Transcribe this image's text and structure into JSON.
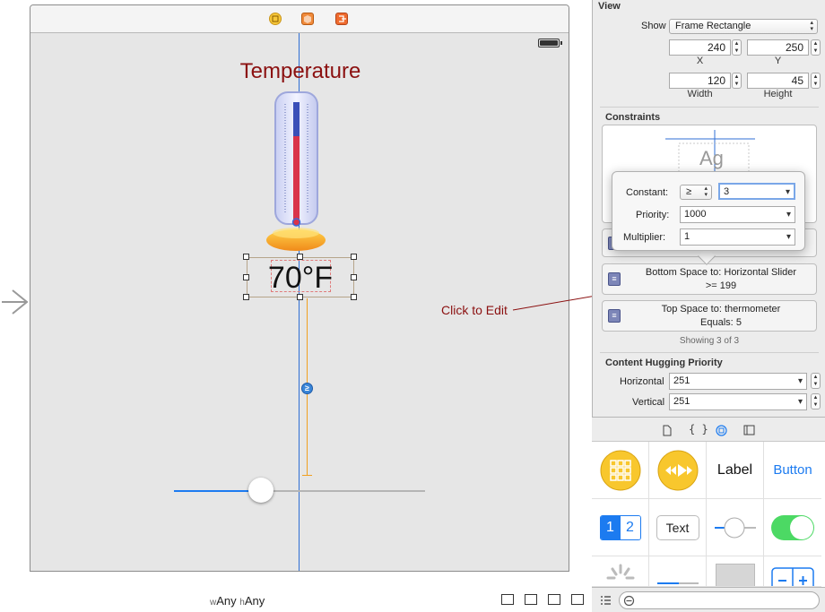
{
  "scene": {
    "title_label": "Temperature",
    "value_label": "70°F",
    "slider": {
      "value_fraction": 0.35
    },
    "constraint_badge": "≥",
    "dock_icons": [
      "view-controller-icon",
      "first-responder-icon",
      "exit-icon"
    ]
  },
  "bottom_bar": {
    "w_prefix": "w",
    "w_value": "Any",
    "h_prefix": "h",
    "h_value": "Any"
  },
  "annotation": {
    "text": "Click to Edit"
  },
  "inspector": {
    "view": {
      "heading": "View",
      "show_label": "Show",
      "show_value": "Frame Rectangle",
      "x": "240",
      "y": "250",
      "x_label": "X",
      "y_label": "Y",
      "width": "120",
      "height": "45",
      "width_label": "Width",
      "height_label": "Height"
    },
    "constraints": {
      "heading": "Constraints",
      "preview_text": "Ag",
      "items": [
        {
          "label": "Bottom Space to:",
          "target": "Horizontal Slider",
          "relation": ">=",
          "value": "199"
        },
        {
          "label": "Top Space to:",
          "target": "thermometer",
          "relation": "Equals:",
          "value": "5"
        }
      ],
      "showing": "Showing 3 of 3"
    },
    "popover": {
      "constant_label": "Constant:",
      "constant_relation": "≥",
      "constant_value": "3",
      "priority_label": "Priority:",
      "priority_value": "1000",
      "multiplier_label": "Multiplier:",
      "multiplier_value": "1"
    },
    "hugging": {
      "heading": "Content Hugging Priority",
      "horizontal_label": "Horizontal",
      "horizontal_value": "251",
      "vertical_label": "Vertical",
      "vertical_value": "251"
    }
  },
  "library": {
    "tabs": [
      "file-template-icon",
      "code-snippet-icon",
      "object-library-icon",
      "media-library-icon"
    ],
    "items": {
      "label": "Label",
      "button": "Button",
      "segment_1": "1",
      "segment_2": "2",
      "text_field": "Text"
    }
  },
  "colors": {
    "title": "#8b1010",
    "accent": "#1c7bf0",
    "constraint": "#f0a020",
    "guide": "#2f6fd4",
    "switch_on": "#4cd964"
  }
}
